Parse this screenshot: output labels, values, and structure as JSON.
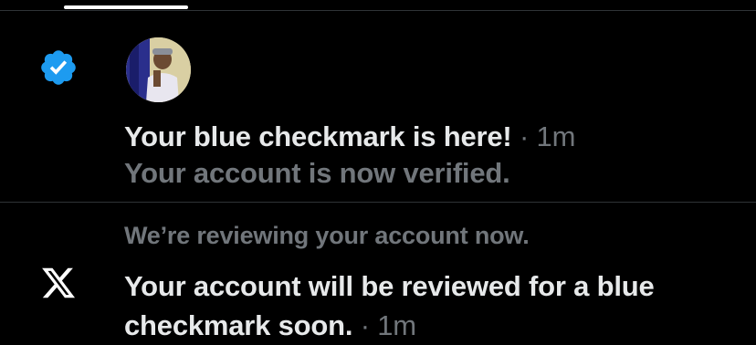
{
  "tabs": {
    "active_indicator": "active-tab-underline"
  },
  "notifications": [
    {
      "icon": "verified-badge-icon",
      "icon_color": "#1d9bf0",
      "avatar": "user-avatar",
      "title": "Your blue checkmark is here!",
      "separator": "·",
      "time": "1m",
      "subtitle": "Your account is now verified."
    },
    {
      "icon": "x-logo-icon",
      "header": "We’re reviewing your account now.",
      "body_line1": "Your account will be reviewed for a blue",
      "body_line2": "checkmark soon.",
      "separator": "·",
      "time": "1m"
    }
  ],
  "colors": {
    "background": "#000000",
    "primary_text": "#e7e9ea",
    "secondary_text": "#71767b",
    "divider": "#2f3336",
    "verified_blue": "#1d9bf0"
  }
}
